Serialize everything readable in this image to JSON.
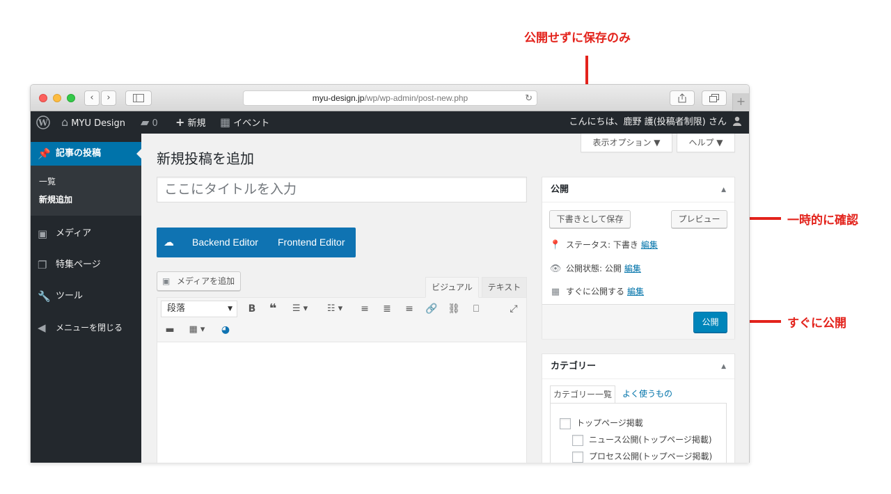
{
  "annotations": {
    "save_only": "公開せずに保存のみ",
    "preview_note": "一時的に確認",
    "publish_now": "すぐに公開",
    "color": "#e3231c"
  },
  "browser": {
    "url_domain": "myu-design.jp",
    "url_path": "/wp/wp-admin/post-new.php",
    "back_icon": "chevron-left-icon",
    "forward_icon": "chevron-right-icon"
  },
  "adminbar": {
    "site_name": "MYU Design",
    "comments_count": "0",
    "new_label": "新規",
    "event_label": "イベント",
    "greeting": "こんにちは、鹿野 護(投稿者制限) さん"
  },
  "sidebar": {
    "current": "記事の投稿",
    "sub_items": [
      "一覧",
      "新規追加"
    ],
    "items": [
      {
        "label": "メディア",
        "icon": "media-icon"
      },
      {
        "label": "特集ページ",
        "icon": "pages-icon"
      },
      {
        "label": "ツール",
        "icon": "wrench-icon"
      },
      {
        "label": "メニューを閉じる",
        "icon": "collapse-icon"
      }
    ]
  },
  "screen_options": {
    "display_options": "表示オプション ▼",
    "help": "ヘルプ ▼"
  },
  "main": {
    "page_title": "新規投稿を追加",
    "title_placeholder": "ここにタイトルを入力",
    "backend_editor": "Backend Editor",
    "frontend_editor": "Frontend Editor",
    "add_media": "メディアを追加",
    "tab_visual": "ビジュアル",
    "tab_text": "テキスト",
    "format_select": "段落"
  },
  "publish_box": {
    "title": "公開",
    "save_draft": "下書きとして保存",
    "preview": "プレビュー",
    "status_label": "ステータス: 下書き",
    "visibility_label": "公開状態: 公開",
    "schedule_label": "すぐに公開する",
    "edit_link": "編集",
    "publish_button": "公開"
  },
  "category_box": {
    "title": "カテゴリー",
    "tab_all": "カテゴリー一覧",
    "tab_popular": "よく使うもの",
    "categories": [
      "トップページ掲載",
      "ニュース公開(トップページ掲載)",
      "プロセス公開(トップページ掲載)"
    ]
  },
  "colors": {
    "admin_dark": "#23282d",
    "wp_blue": "#0073aa",
    "primary_button": "#0085ba",
    "vc_blue": "#0f73b2"
  }
}
